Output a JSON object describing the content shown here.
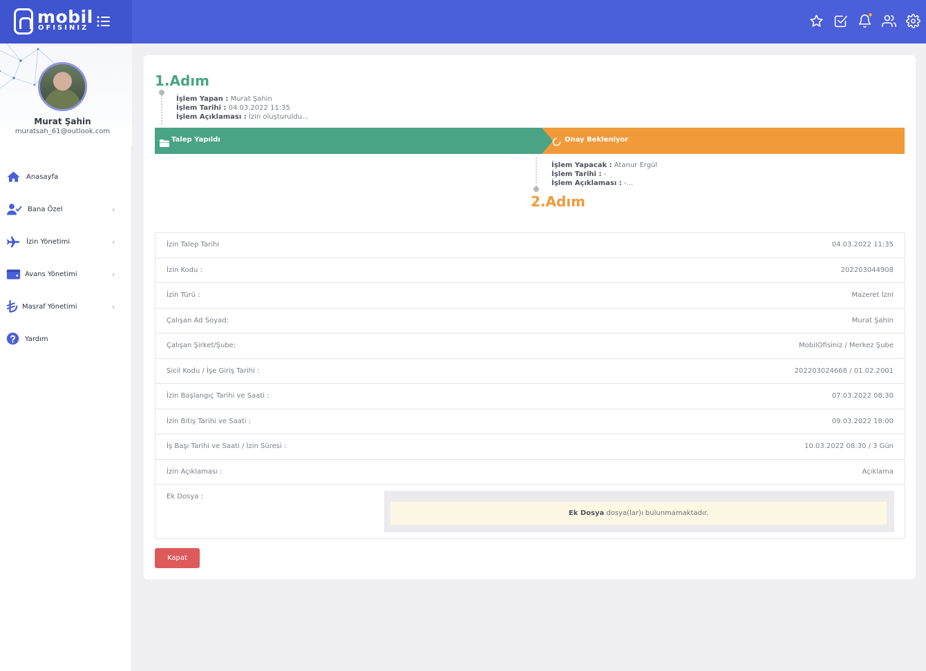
{
  "header": {
    "logo_line1": "mobil",
    "logo_line2": "OFISINIZ",
    "accent_color": "#4a5fd8",
    "icons": [
      "menu-icon",
      "star-icon",
      "check-square-icon",
      "bell-icon",
      "users-icon",
      "gear-icon"
    ]
  },
  "profile": {
    "name": "Murat Şahin",
    "email": "muratsah_61@outlook.com"
  },
  "sidebar": {
    "items": [
      {
        "label": "Anasayfa",
        "icon": "home-icon",
        "has_children": false
      },
      {
        "label": "Bana Özel",
        "icon": "user-check-icon",
        "has_children": true
      },
      {
        "label": "İzin Yönetimi",
        "icon": "plane-icon",
        "has_children": true
      },
      {
        "label": "Avans Yönetimi",
        "icon": "wallet-icon",
        "has_children": true
      },
      {
        "label": "Masraf Yönetimi",
        "icon": "lira-icon",
        "has_children": true
      },
      {
        "label": "Yardım",
        "icon": "help-icon",
        "has_children": false
      }
    ],
    "chevron": "›"
  },
  "step1": {
    "title": "1.Adım",
    "actor_label": "İşlem Yapan :",
    "actor_value": "Murat Şahin",
    "date_label": "İşlem Tarihi :",
    "date_value": "04.03.2022 11:35",
    "desc_label": "İşlem Açıklaması :",
    "desc_value": "İzin oluşturuldu..."
  },
  "progress": {
    "done_label": "Talep Yapıldı",
    "done_color": "#4aa385",
    "wait_label": "Onay Bekleniyor",
    "wait_color": "#f09a3a"
  },
  "step2": {
    "title": "2.Adım",
    "actor_label": "İşlem Yapacak :",
    "actor_value": "Atanur Ergül",
    "date_label": "İşlem Tarihi :",
    "date_value": "-",
    "desc_label": "İşlem Açıklaması :",
    "desc_value": "-..."
  },
  "details": [
    {
      "label": "İzin Talep Tarihi",
      "value": "04.03.2022 11:35"
    },
    {
      "label": "İzin Kodu :",
      "value": "202203044908"
    },
    {
      "label": "İzin Türü :",
      "value": "Mazeret İzni"
    },
    {
      "label": "Çalışan Ad Soyad:",
      "value": "Murat Şahin"
    },
    {
      "label": "Çalışan Şirket/Şube:",
      "value": "MobilOfisiniz / Merkez Şube"
    },
    {
      "label": "Sicil Kodu / İşe Giriş Tarihi :",
      "value": "202203024668 / 01.02.2001"
    },
    {
      "label": "İzin Başlangıç Tarihi ve Saati :",
      "value": "07.03.2022 08:30"
    },
    {
      "label": "İzin Bitiş Tarihi ve Saati :",
      "value": "09.03.2022 18:00"
    },
    {
      "label": "İş Başı Tarihi ve Saati / İzin Süresi :",
      "value": "10.03.2022 08:30 / 3 Gün"
    },
    {
      "label": "İzin Açıklaması :",
      "value": "Açıklama"
    }
  ],
  "attachment": {
    "label": "Ek Dosya :",
    "msg_bold": "Ek Dosya",
    "msg_rest": " dosya(lar)ı bulunmamaktadır."
  },
  "close_button": "Kapat",
  "close_color": "#de5a5a"
}
